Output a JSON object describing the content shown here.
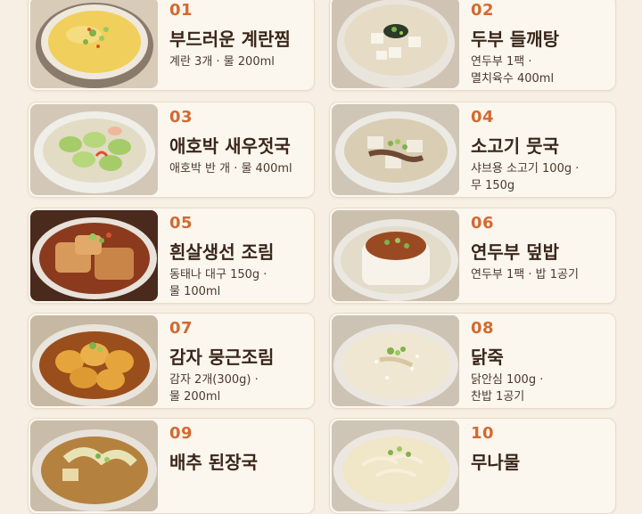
{
  "recipes": [
    {
      "number": "01",
      "title": "부드러운 계란찜",
      "desc1": "계란 3개 · 물 200ml",
      "desc2": "",
      "image": "steamed-egg-image"
    },
    {
      "number": "02",
      "title": "두부 들깨탕",
      "desc1": "연두부 1팩 ·",
      "desc2": "멸치육수 400ml",
      "image": "tofu-perilla-soup-image"
    },
    {
      "number": "03",
      "title": "애호박 새우젓국",
      "desc1": "애호박 반 개 · 물 400ml",
      "desc2": "",
      "image": "zucchini-shrimp-soup-image"
    },
    {
      "number": "04",
      "title": "소고기 뭇국",
      "desc1": "샤브용 소고기 100g ·",
      "desc2": "무 150g",
      "image": "beef-radish-soup-image"
    },
    {
      "number": "05",
      "title": "흰살생선 조림",
      "desc1": "동태나 대구 150g ·",
      "desc2": "물 100ml",
      "image": "braised-fish-image"
    },
    {
      "number": "06",
      "title": "연두부 덮밥",
      "desc1": "연두부 1팩 · 밥 1공기",
      "desc2": "",
      "image": "soft-tofu-rice-bowl-image"
    },
    {
      "number": "07",
      "title": "감자 뭉근조림",
      "desc1": "감자 2개(300g) ·",
      "desc2": "물 200ml",
      "image": "braised-potato-image"
    },
    {
      "number": "08",
      "title": "닭죽",
      "desc1": "닭안심 100g ·",
      "desc2": "찬밥 1공기",
      "image": "chicken-porridge-image"
    },
    {
      "number": "09",
      "title": "배추 된장국",
      "desc1": "",
      "desc2": "",
      "image": "cabbage-doenjang-soup-image"
    },
    {
      "number": "10",
      "title": "무나물",
      "desc1": "",
      "desc2": "",
      "image": "seasoned-radish-image"
    }
  ]
}
